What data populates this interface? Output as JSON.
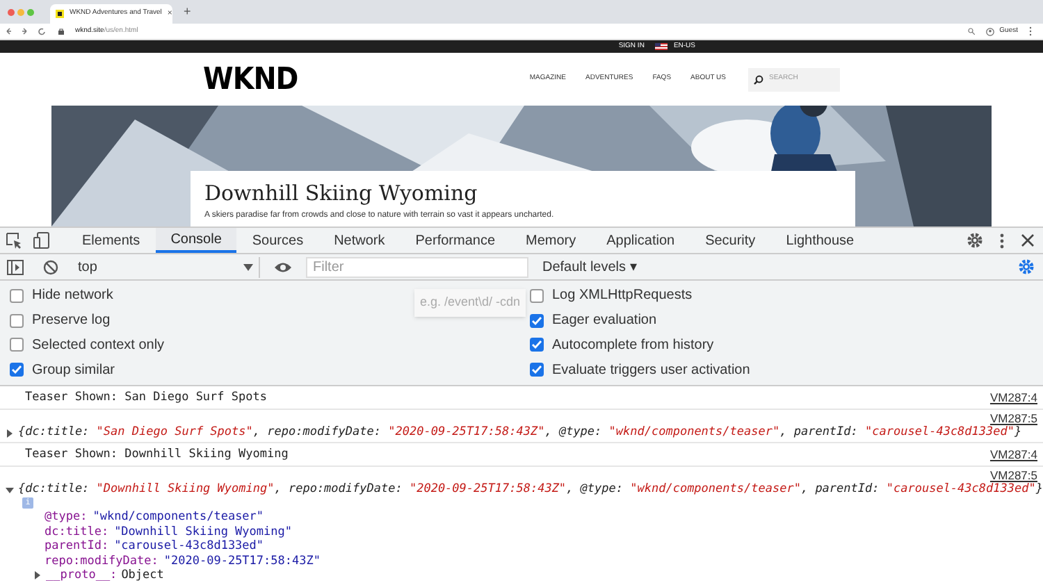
{
  "browser": {
    "tab_title": "WKND Adventures and Travel",
    "new_tab": "+",
    "close": "×",
    "url_host": "wknd.site",
    "url_path": "/us/en.html",
    "profile": "Guest"
  },
  "site": {
    "top_bar": {
      "sign_in": "SIGN IN",
      "language": "EN-US"
    },
    "logo": "WKND",
    "nav": [
      {
        "label": "MAGAZINE"
      },
      {
        "label": "ADVENTURES"
      },
      {
        "label": "FAQS"
      },
      {
        "label": "ABOUT US"
      }
    ],
    "search": {
      "placeholder": "SEARCH"
    },
    "teaser": {
      "title": "Downhill Skiing Wyoming",
      "description": "A skiers paradise far from crowds and close to nature with terrain so vast it appears uncharted."
    }
  },
  "devtools": {
    "tabs": [
      {
        "label": "Elements",
        "selected": false
      },
      {
        "label": "Console",
        "selected": true
      },
      {
        "label": "Sources",
        "selected": false
      },
      {
        "label": "Network",
        "selected": false
      },
      {
        "label": "Performance",
        "selected": false
      },
      {
        "label": "Memory",
        "selected": false
      },
      {
        "label": "Application",
        "selected": false
      },
      {
        "label": "Security",
        "selected": false
      },
      {
        "label": "Lighthouse",
        "selected": false
      }
    ],
    "context": "top",
    "filter": {
      "placeholder": "Filter"
    },
    "levels": "Default levels ▾",
    "filter_hint": "e.g. /event\\d/ -cdn",
    "settings_left": [
      {
        "label": "Hide network",
        "checked": false
      },
      {
        "label": "Preserve log",
        "checked": false
      },
      {
        "label": "Selected context only",
        "checked": false
      },
      {
        "label": "Group similar",
        "checked": true
      }
    ],
    "settings_right": [
      {
        "label": "Log XMLHttpRequests",
        "checked": false
      },
      {
        "label": "Eager evaluation",
        "checked": true
      },
      {
        "label": "Autocomplete from history",
        "checked": true
      },
      {
        "label": "Evaluate triggers user activation",
        "checked": true
      }
    ],
    "messages": [
      {
        "kind": "text",
        "text": "Teaser Shown: San Diego Surf Spots",
        "source": "VM287:4"
      },
      {
        "kind": "object",
        "source": "VM287:5",
        "expanded": false,
        "summary": [
          {
            "kind": "key",
            "text": "{dc:title: "
          },
          {
            "kind": "string",
            "text": "\"San Diego Surf Spots\""
          },
          {
            "kind": "key",
            "text": ", repo:modifyDate: "
          },
          {
            "kind": "string",
            "text": "\"2020-09-25T17:58:43Z\""
          },
          {
            "kind": "key",
            "text": ", @type: "
          },
          {
            "kind": "string",
            "text": "\"wknd/components/teaser\""
          },
          {
            "kind": "key",
            "text": ", parentId: "
          },
          {
            "kind": "string",
            "text": "\"carousel-43c8d133ed\""
          },
          {
            "kind": "key",
            "text": "}"
          }
        ]
      },
      {
        "kind": "text",
        "text": "Teaser Shown: Downhill Skiing Wyoming",
        "source": "VM287:4"
      },
      {
        "kind": "object",
        "source": "VM287:5",
        "expanded": true,
        "info": "i",
        "summary": [
          {
            "kind": "key",
            "text": "{dc:title: "
          },
          {
            "kind": "string",
            "text": "\"Downhill Skiing Wyoming\""
          },
          {
            "kind": "key",
            "text": ", repo:modifyDate: "
          },
          {
            "kind": "string",
            "text": "\"2020-09-25T17:58:43Z\""
          },
          {
            "kind": "key",
            "text": ", @type: "
          },
          {
            "kind": "string",
            "text": "\"wknd/components/teaser\""
          },
          {
            "kind": "key",
            "text": ", parentId: "
          },
          {
            "kind": "string",
            "text": "\"carousel-43c8d133ed\""
          },
          {
            "kind": "key",
            "text": "}"
          }
        ],
        "properties": [
          {
            "key": "@type:",
            "value": "\"wknd/components/teaser\""
          },
          {
            "key": "dc:title:",
            "value": "\"Downhill Skiing Wyoming\""
          },
          {
            "key": "parentId:",
            "value": "\"carousel-43c8d133ed\""
          },
          {
            "key": "repo:modifyDate:",
            "value": "\"2020-09-25T17:58:43Z\""
          }
        ],
        "proto": {
          "key": "__proto__:",
          "value": "Object"
        }
      }
    ]
  }
}
